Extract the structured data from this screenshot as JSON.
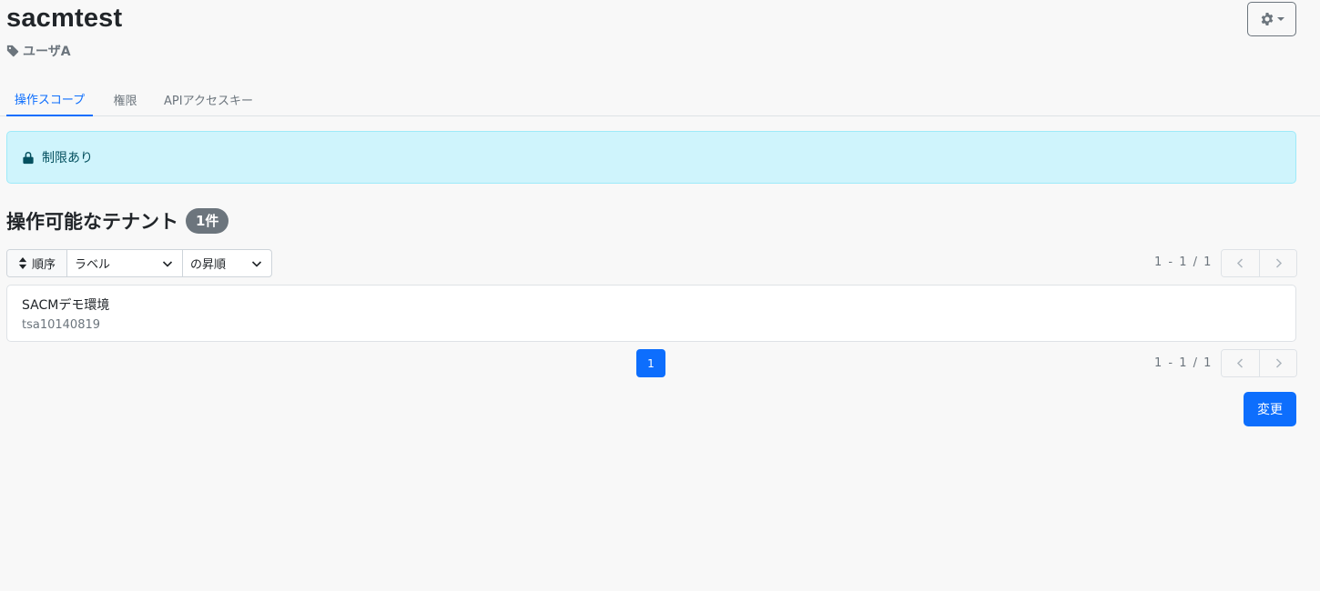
{
  "header": {
    "title": "sacmtest",
    "tag_label": "ユーザA"
  },
  "tabs": [
    {
      "label": "操作スコープ",
      "active": true
    },
    {
      "label": "権限",
      "active": false
    },
    {
      "label": "APIアクセスキー",
      "active": false
    }
  ],
  "alert": {
    "text": "制限あり"
  },
  "section": {
    "title": "操作可能なテナント",
    "count_badge": "1件"
  },
  "sort": {
    "label": "順序",
    "field": "ラベル",
    "order": "の昇順"
  },
  "pager_top": {
    "range_text": "1 - 1 / 1"
  },
  "pager_bottom": {
    "range_text": "1 - 1 / 1"
  },
  "tenants": [
    {
      "name": "SACMデモ環境",
      "id": "tsa10140819"
    }
  ],
  "pagination": {
    "current_page": "1"
  },
  "actions": {
    "submit_label": "変更"
  },
  "colors": {
    "primary": "#0d6efd",
    "alert_bg": "#cff4fc",
    "badge_bg": "#6c757d"
  },
  "icons": [
    "tag-icon",
    "gear-icon",
    "lock-icon",
    "sort-icon",
    "chevron-down-icon",
    "chevron-left-icon",
    "chevron-right-icon"
  ]
}
